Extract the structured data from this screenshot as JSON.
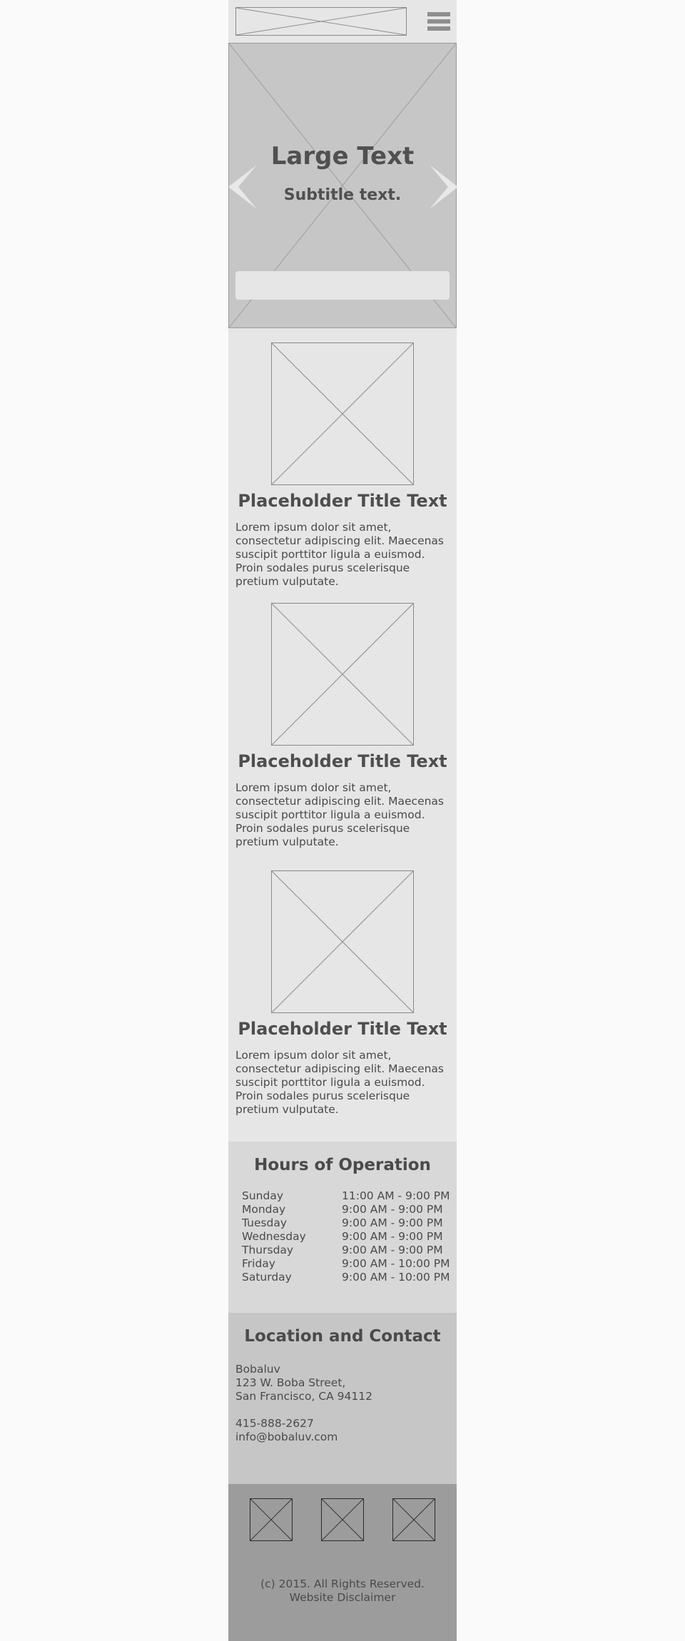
{
  "header": {
    "logo_icon": "image-placeholder-icon",
    "menu_icon": "hamburger-menu-icon"
  },
  "hero": {
    "title": "Large Text",
    "subtitle": "Subtitle text.",
    "prev_icon": "chevron-left-icon",
    "next_icon": "chevron-right-icon",
    "arrow_color": "#e8e8e8"
  },
  "features": [
    {
      "title": "Placeholder Title Text",
      "text": "Lorem ipsum dolor sit amet, consectetur adipiscing elit. Maecenas suscipit porttitor ligula a euismod. Proin sodales purus scelerisque pretium vulputate."
    },
    {
      "title": "Placeholder Title Text",
      "text": "Lorem ipsum dolor sit amet, consectetur adipiscing elit. Maecenas suscipit porttitor ligula a euismod. Proin sodales purus scelerisque pretium vulputate."
    },
    {
      "title": "Placeholder Title Text",
      "text": "Lorem ipsum dolor sit amet, consectetur adipiscing elit. Maecenas suscipit porttitor ligula a euismod. Proin sodales purus scelerisque pretium vulputate."
    }
  ],
  "hours": {
    "title": "Hours of Operation",
    "rows": [
      {
        "day": "Sunday",
        "time": "11:00 AM - 9:00 PM"
      },
      {
        "day": "Monday",
        "time": "9:00 AM - 9:00 PM"
      },
      {
        "day": "Tuesday",
        "time": "9:00 AM - 9:00 PM"
      },
      {
        "day": "Wednesday",
        "time": "9:00 AM - 9:00 PM"
      },
      {
        "day": "Thursday",
        "time": "9:00 AM - 9:00 PM"
      },
      {
        "day": "Friday",
        "time": "9:00 AM - 10:00 PM"
      },
      {
        "day": "Saturday",
        "time": "9:00 AM - 10:00 PM"
      }
    ]
  },
  "contact": {
    "title": "Location and Contact",
    "name": "Bobaluv",
    "street": "123 W. Boba Street,",
    "city": "San Francisco, CA 94112",
    "phone": "415-888-2627",
    "email": "info@bobaluv.com"
  },
  "footer": {
    "social_icons": [
      "social-placeholder-icon",
      "social-placeholder-icon",
      "social-placeholder-icon"
    ],
    "copyright": "(c) 2015. All Rights Reserved.",
    "disclaimer": "Website Disclaimer"
  }
}
